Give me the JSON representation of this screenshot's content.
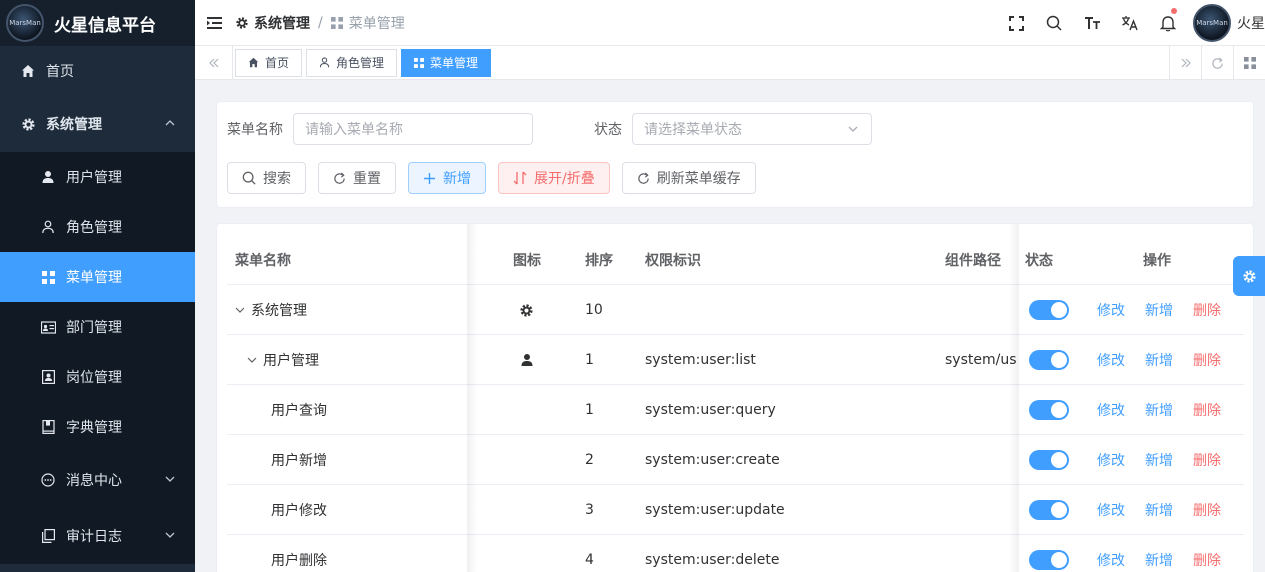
{
  "brand": {
    "title": "火星信息平台",
    "logo_text": "MarsMan"
  },
  "sidebar": {
    "items": [
      {
        "label": "首页"
      },
      {
        "label": "系统管理"
      },
      {
        "label": "用户管理"
      },
      {
        "label": "角色管理"
      },
      {
        "label": "菜单管理"
      },
      {
        "label": "部门管理"
      },
      {
        "label": "岗位管理"
      },
      {
        "label": "字典管理"
      },
      {
        "label": "消息中心"
      },
      {
        "label": "审计日志"
      }
    ]
  },
  "header": {
    "breadcrumb": [
      "系统管理",
      "菜单管理"
    ],
    "user_name": "火星",
    "avatar_text": "MarsMan"
  },
  "tags": [
    {
      "label": "首页"
    },
    {
      "label": "角色管理"
    },
    {
      "label": "菜单管理"
    }
  ],
  "search": {
    "menu_name_label": "菜单名称",
    "menu_name_placeholder": "请输入菜单名称",
    "status_label": "状态",
    "status_placeholder": "请选择菜单状态",
    "buttons": {
      "search": "搜索",
      "reset": "重置",
      "add": "新增",
      "expand": "展开/折叠",
      "refresh_cache": "刷新菜单缓存"
    }
  },
  "table": {
    "headers": {
      "name": "菜单名称",
      "icon": "图标",
      "sort": "排序",
      "perm": "权限标识",
      "component": "组件路径",
      "status": "状态",
      "action": "操作"
    },
    "actions": {
      "edit": "修改",
      "add": "新增",
      "delete": "删除"
    },
    "rows": [
      {
        "name": "系统管理",
        "icon": "gear-icon",
        "sort": "10",
        "perm": "",
        "component": ""
      },
      {
        "name": "用户管理",
        "icon": "user-icon",
        "sort": "1",
        "perm": "system:user:list",
        "component": "system/use"
      },
      {
        "name": "用户查询",
        "icon": "",
        "sort": "1",
        "perm": "system:user:query",
        "component": ""
      },
      {
        "name": "用户新增",
        "icon": "",
        "sort": "2",
        "perm": "system:user:create",
        "component": ""
      },
      {
        "name": "用户修改",
        "icon": "",
        "sort": "3",
        "perm": "system:user:update",
        "component": ""
      },
      {
        "name": "用户删除",
        "icon": "",
        "sort": "4",
        "perm": "system:user:delete",
        "component": ""
      }
    ]
  },
  "colors": {
    "primary": "#409eff",
    "danger": "#f56c6c",
    "sidebar_bg": "#1d2b3a"
  }
}
